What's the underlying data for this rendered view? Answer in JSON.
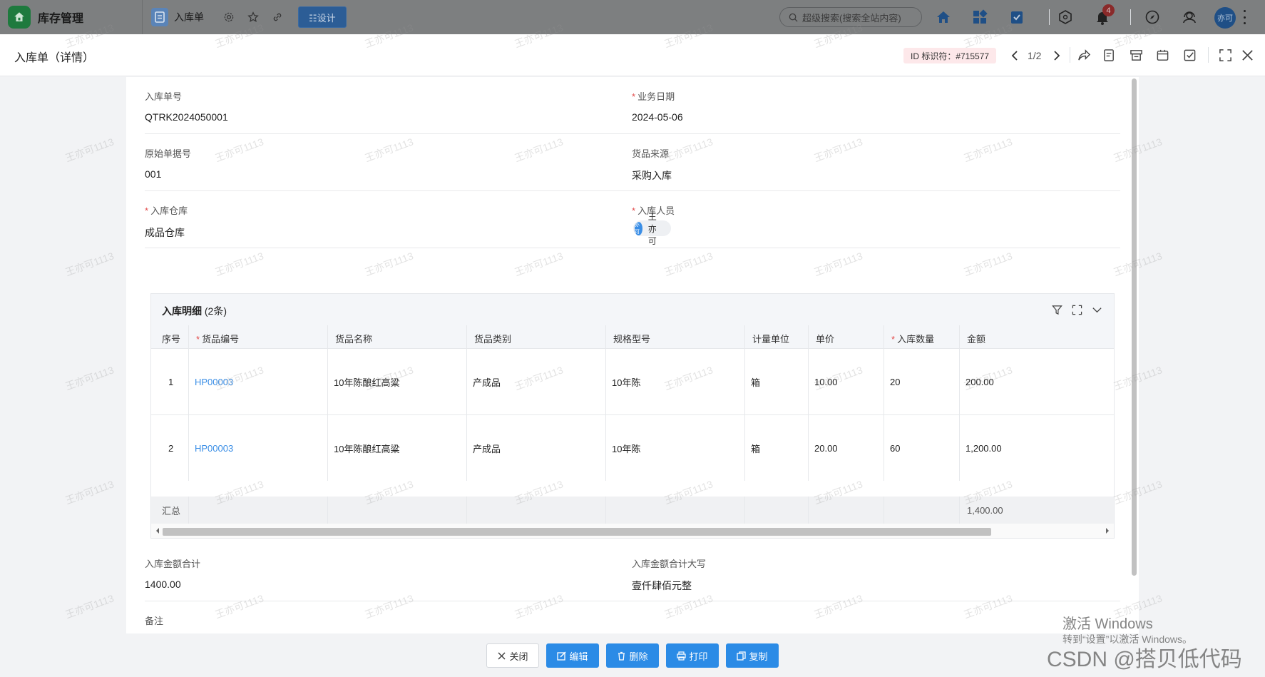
{
  "topbar": {
    "app_name": "库存管理",
    "doc_tab_label": "入库单",
    "design_label": "☷设计",
    "search_placeholder": "超级搜索(搜索全站内容)",
    "notification_count": "4",
    "user_avatar_text": "亦可"
  },
  "modal": {
    "title": "入库单（详情）",
    "id_tag": "ID 标识符：#715577",
    "pager": "1/2"
  },
  "fields": {
    "order_no": {
      "label": "入库单号",
      "value": "QTRK2024050001"
    },
    "biz_date": {
      "label": "业务日期",
      "value": "2024-05-06"
    },
    "origin_no": {
      "label": "原始单据号",
      "value": "001"
    },
    "source": {
      "label": "货品来源",
      "value": "采购入库"
    },
    "warehouse": {
      "label": "入库仓库",
      "value": "成品仓库"
    },
    "operator": {
      "label": "入库人员",
      "value": "王亦可",
      "avatar_text": "亦可"
    },
    "amount_total": {
      "label": "入库金额合计",
      "value": "1400.00"
    },
    "amount_upper": {
      "label": "入库金额合计大写",
      "value": "壹仟肆佰元整"
    },
    "remark": {
      "label": "备注",
      "value": "--"
    }
  },
  "detail_table": {
    "title": "入库明细",
    "count": "(2条)",
    "columns": [
      "序号",
      "货品编号",
      "货品名称",
      "货品类别",
      "规格型号",
      "计量单位",
      "单价",
      "入库数量",
      "金额"
    ],
    "rows": [
      [
        "1",
        "HP00003",
        "10年陈酿红高粱",
        "产成品",
        "10年陈",
        "箱",
        "10.00",
        "20",
        "200.00"
      ],
      [
        "2",
        "HP00003",
        "10年陈酿红高粱",
        "产成品",
        "10年陈",
        "箱",
        "20.00",
        "60",
        "1,200.00"
      ]
    ],
    "summary_label": "汇总",
    "summary_amount": "1,400.00"
  },
  "footer": {
    "close": "关闭",
    "edit": "编辑",
    "delete": "删除",
    "print": "打印",
    "copy": "复制"
  },
  "watermark_text": "王亦可1113",
  "windows_activate": {
    "title": "激活 Windows",
    "subtitle": "转到“设置”以激活 Windows。"
  },
  "csdn_mark": "CSDN @搭贝低代码",
  "colors": {
    "primary": "#2b8be6",
    "required": "#e34d4d",
    "link": "#3a8ee6",
    "id_tag_bg": "#fde8ea"
  }
}
